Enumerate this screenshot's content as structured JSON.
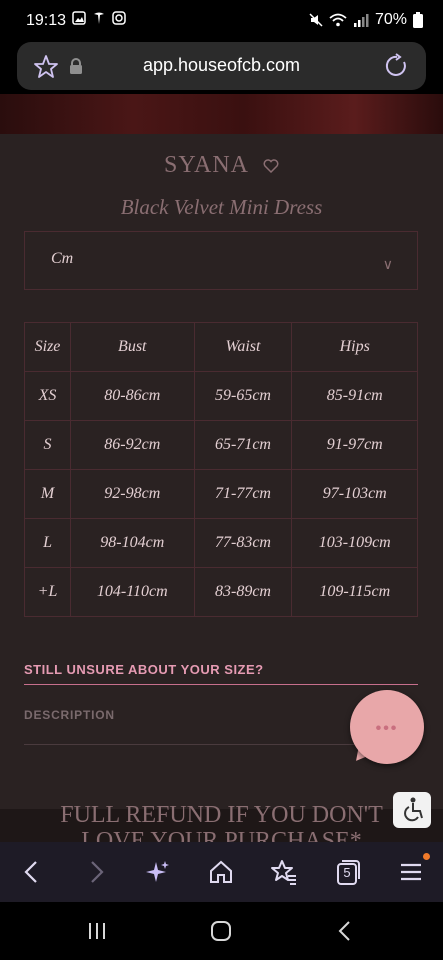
{
  "status": {
    "time": "19:13",
    "battery": "70%"
  },
  "browser": {
    "url": "app.houseofcb.com",
    "tab_count": "5"
  },
  "product": {
    "brand": "SYANA",
    "name": "Black Velvet Mini Dress"
  },
  "unit_select": {
    "value": "Cm"
  },
  "size_table": {
    "headers": [
      "Size",
      "Bust",
      "Waist",
      "Hips"
    ],
    "rows": [
      [
        "XS",
        "80-86cm",
        "59-65cm",
        "85-91cm"
      ],
      [
        "S",
        "86-92cm",
        "65-71cm",
        "91-97cm"
      ],
      [
        "M",
        "92-98cm",
        "71-77cm",
        "97-103cm"
      ],
      [
        "L",
        "98-104cm",
        "77-83cm",
        "103-109cm"
      ],
      [
        "+L",
        "104-110cm",
        "83-89cm",
        "109-115cm"
      ]
    ]
  },
  "links": {
    "unsure": "STILL UNSURE ABOUT YOUR SIZE?",
    "description": "DESCRIPTION"
  },
  "refund": {
    "line1": "FULL REFUND IF YOU DON'T",
    "line2": "LOVE YOUR PURCHASE*"
  },
  "chat": {
    "dots": "•••"
  },
  "colors": {
    "accent_pink": "#e69bb3",
    "chat_bubble": "#e8a7a9",
    "table_border": "#4a2b31"
  }
}
